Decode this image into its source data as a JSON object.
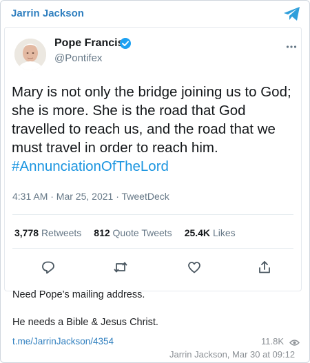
{
  "channel": {
    "name": "Jarrin Jackson",
    "link": "t.me/JarrinJackson/4354",
    "views": "11.8K",
    "footer": "Jarrin Jackson, Mar 30 at 09:12"
  },
  "tweet": {
    "author_name": "Pope Francis",
    "author_handle": "@Pontifex",
    "text": "Mary is not only the bridge joining us to God; she is more. She is the road that God travelled to reach us, and the road that we must travel in order to reach him. ",
    "hashtag": "#AnnunciationOfTheLord",
    "meta": "4:31 AM · Mar 25, 2021 · TweetDeck",
    "stats": {
      "retweets_count": "3,778",
      "retweets_label": "Retweets",
      "quotes_count": "812",
      "quotes_label": "Quote Tweets",
      "likes_count": "25.4K",
      "likes_label": "Likes"
    }
  },
  "message": {
    "line1": "Need Pope’s mailing address.",
    "line2": "He needs a Bible & Jesus Christ."
  },
  "colors": {
    "link_blue": "#2f7fbf",
    "twitter_blue": "#1b95e0",
    "verified_blue": "#1da1f2"
  },
  "icons": [
    "telegram-icon",
    "verified-icon",
    "more-icon",
    "reply-icon",
    "retweet-icon",
    "like-icon",
    "share-icon",
    "eye-icon"
  ]
}
